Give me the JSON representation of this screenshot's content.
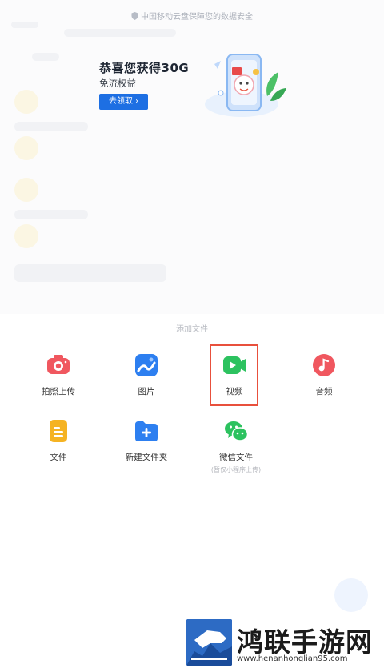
{
  "notice": {
    "text": "中国移动云盘保障您的数据安全"
  },
  "promo": {
    "title": "恭喜您获得30G",
    "subtitle": "免流权益",
    "button": "去领取 ›"
  },
  "sheet": {
    "title": "添加文件",
    "items": [
      {
        "label": "拍照上传",
        "icon": "camera-icon",
        "color": "#f0575f"
      },
      {
        "label": "图片",
        "icon": "image-icon",
        "color": "#2d7ff0"
      },
      {
        "label": "视频",
        "icon": "video-icon",
        "color": "#2cc25f",
        "highlighted": true
      },
      {
        "label": "音频",
        "icon": "music-icon",
        "color": "#f0575f"
      },
      {
        "label": "文件",
        "icon": "document-icon",
        "color": "#f5b323"
      },
      {
        "label": "新建文件夹",
        "icon": "new-folder-icon",
        "color": "#2d7ff0"
      },
      {
        "label": "微信文件",
        "sublabel": "(暂仅小程序上传)",
        "icon": "wechat-icon",
        "color": "#2cc25f"
      }
    ]
  },
  "watermark": {
    "name": "鸿联手游网",
    "url": "www.henanhonglian95.com"
  },
  "colors": {
    "accent": "#1d6fe3",
    "highlight": "#e8503c"
  }
}
